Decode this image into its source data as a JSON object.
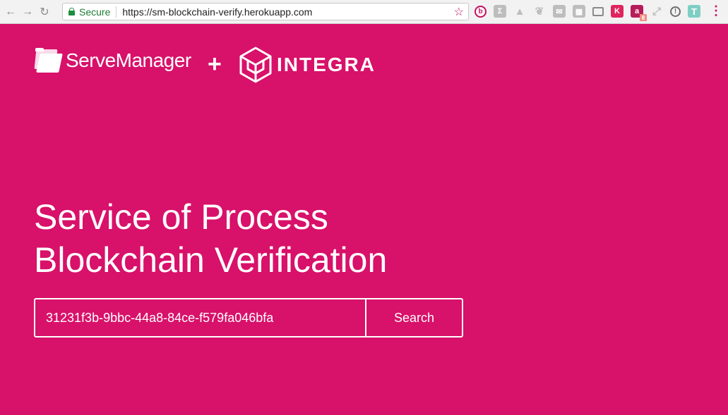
{
  "browser": {
    "secure_label": "Secure",
    "url": "https://sm-blockchain-verify.herokuapp.com",
    "extensions": [
      {
        "name": "b-icon",
        "glyph": "b"
      },
      {
        "name": "sigma-icon",
        "glyph": "Σ"
      },
      {
        "name": "drive-icon",
        "glyph": "▲"
      },
      {
        "name": "leaf-icon",
        "glyph": "❦"
      },
      {
        "name": "mail-icon",
        "glyph": "✉"
      },
      {
        "name": "grid-icon",
        "glyph": "▦"
      },
      {
        "name": "cast-icon",
        "glyph": ""
      },
      {
        "name": "k-icon",
        "glyph": "K"
      },
      {
        "name": "a-icon",
        "glyph": "a",
        "badge": "8"
      },
      {
        "name": "link-icon",
        "glyph": "⤢"
      },
      {
        "name": "info-icon",
        "glyph": "!"
      },
      {
        "name": "t-icon",
        "glyph": "T"
      }
    ]
  },
  "logos": {
    "servemanager": "ServeManager",
    "plus": "+",
    "integra": "INTEGRA"
  },
  "headline": {
    "line1": "Service of Process",
    "line2": "Blockchain Verification"
  },
  "search": {
    "value": "31231f3b-9bbc-44a8-84ce-f579fa046bfa",
    "button_label": "Search"
  },
  "colors": {
    "background": "#d8116a",
    "accent": "#c7105f"
  }
}
